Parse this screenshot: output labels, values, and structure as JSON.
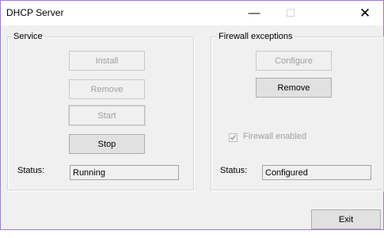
{
  "window": {
    "title": "DHCP Server",
    "minimize_glyph": "—",
    "maximize_glyph": "☐",
    "close_glyph": "✕"
  },
  "service": {
    "group_label": "Service",
    "install_label": "Install",
    "remove_label": "Remove",
    "start_label": "Start",
    "stop_label": "Stop",
    "status_label": "Status:",
    "status_value": "Running"
  },
  "firewall": {
    "group_label": "Firewall exceptions",
    "configure_label": "Configure",
    "remove_label": "Remove",
    "enabled_label": "Firewall enabled",
    "enabled_checked": true,
    "status_label": "Status:",
    "status_value": "Configured"
  },
  "footer": {
    "exit_label": "Exit"
  },
  "icons": {
    "checkmark": "check-icon"
  }
}
